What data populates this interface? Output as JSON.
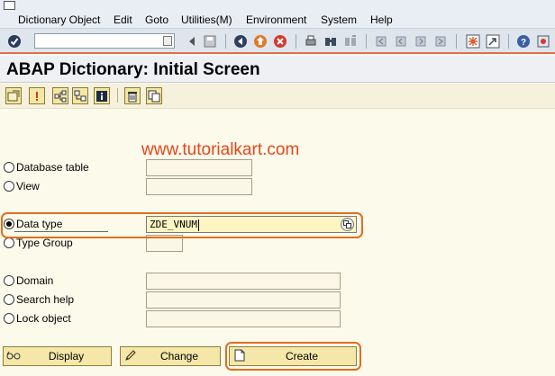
{
  "menu": [
    "Dictionary Object",
    "Edit",
    "Goto",
    "Utilities(M)",
    "Environment",
    "System",
    "Help"
  ],
  "toolbar": {
    "enter_icon": "check-icon",
    "command_field_value": ""
  },
  "page_title": "ABAP Dictionary: Initial Screen",
  "watermark": "www.tutorialkart.com",
  "objects": [
    {
      "label": "Database table",
      "selected": false,
      "value": ""
    },
    {
      "label": "View",
      "selected": false,
      "value": ""
    },
    {
      "label": "Data type",
      "selected": true,
      "value": "ZDE_VNUM"
    },
    {
      "label": "Type Group",
      "selected": false,
      "value": ""
    },
    {
      "label": "Domain",
      "selected": false,
      "value": ""
    },
    {
      "label": "Search help",
      "selected": false,
      "value": ""
    },
    {
      "label": "Lock object",
      "selected": false,
      "value": ""
    }
  ],
  "buttons": {
    "display": "Display",
    "change": "Change",
    "create": "Create"
  },
  "colors": {
    "highlight": "#e26e1b",
    "watermark": "#e8461b",
    "background": "#fcfaeb"
  }
}
